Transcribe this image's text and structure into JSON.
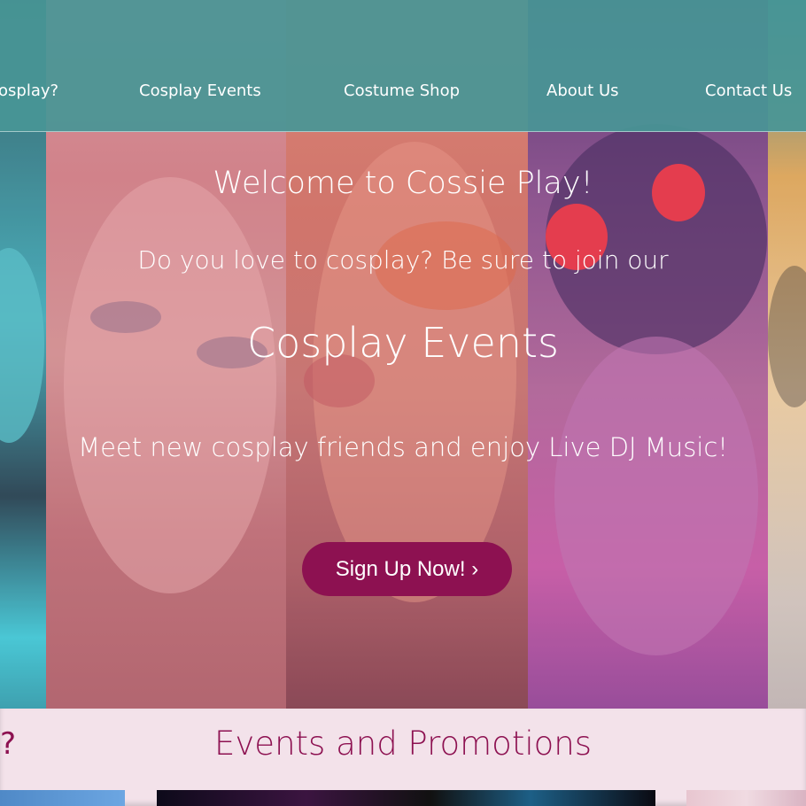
{
  "nav": {
    "items": [
      {
        "label": "osplay?"
      },
      {
        "label": "Cosplay Events"
      },
      {
        "label": "Costume Shop"
      },
      {
        "label": "About Us"
      },
      {
        "label": "Contact Us"
      }
    ]
  },
  "hero": {
    "welcome": "Welcome to Cossie Play!",
    "love": "Do you love to cosplay? Be sure to join our",
    "events": "Cosplay Events",
    "meet": "Meet new cosplay friends and enjoy Live DJ Music!",
    "signup_label": "Sign Up Now! ›"
  },
  "section": {
    "question_mark": "?",
    "title": "Events and Promotions"
  },
  "colors": {
    "nav_bg": "#4c9a9a",
    "accent": "#8d1151",
    "section_bg": "#f3e2ea"
  }
}
